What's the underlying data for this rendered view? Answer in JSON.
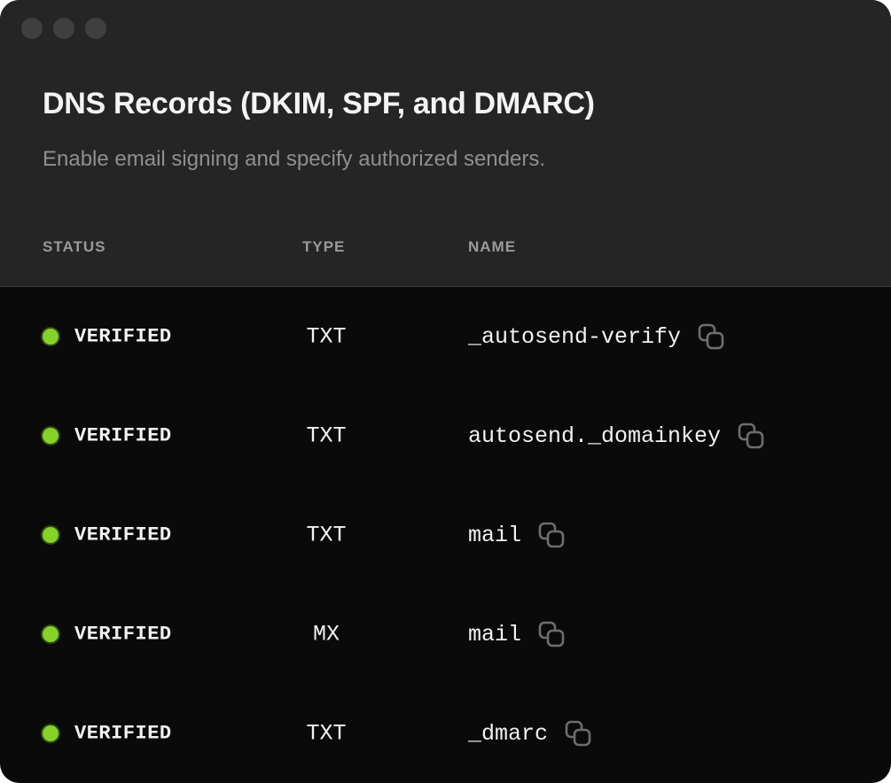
{
  "header": {
    "title": "DNS Records (DKIM, SPF, and DMARC)",
    "subtitle": "Enable email signing and specify authorized senders."
  },
  "table": {
    "columns": {
      "status": "STATUS",
      "type": "TYPE",
      "name": "NAME"
    },
    "rows": [
      {
        "status": "VERIFIED",
        "type": "TXT",
        "name": "_autosend-verify"
      },
      {
        "status": "VERIFIED",
        "type": "TXT",
        "name": "autosend._domainkey"
      },
      {
        "status": "VERIFIED",
        "type": "TXT",
        "name": "mail"
      },
      {
        "status": "VERIFIED",
        "type": "MX",
        "name": "mail"
      },
      {
        "status": "VERIFIED",
        "type": "TXT",
        "name": "_dmarc"
      }
    ]
  },
  "icons": {
    "window_controls": "window-dot-icon",
    "status": "status-dot-icon",
    "copy": "copy-icon"
  },
  "colors": {
    "header_bg": "#252525",
    "body_bg": "#0a0a0a",
    "verified": "#86d12a",
    "muted_text": "#8f8f8f"
  }
}
